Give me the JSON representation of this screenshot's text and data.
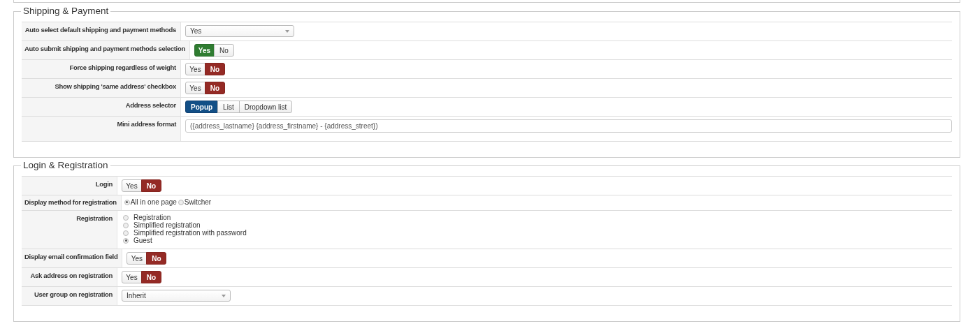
{
  "sections": [
    {
      "title": "Shipping & Payment",
      "rows": [
        {
          "label": "Auto select default shipping and payment methods",
          "kind": "select",
          "value": "Yes"
        },
        {
          "label": "Auto submit shipping and payment methods selection",
          "kind": "toggle",
          "options": [
            {
              "label": "Yes",
              "selected": true
            },
            {
              "label": "No",
              "selected": false
            }
          ]
        },
        {
          "label": "Force shipping regardless of weight",
          "kind": "toggle",
          "options": [
            {
              "label": "Yes",
              "selected": false
            },
            {
              "label": "No",
              "selected": true
            }
          ]
        },
        {
          "label": "Show shipping 'same address' checkbox",
          "kind": "toggle",
          "options": [
            {
              "label": "Yes",
              "selected": false
            },
            {
              "label": "No",
              "selected": true
            }
          ]
        },
        {
          "label": "Address selector",
          "kind": "segmented",
          "options": [
            {
              "label": "Popup",
              "selected": true
            },
            {
              "label": "List",
              "selected": false
            },
            {
              "label": "Dropdown list",
              "selected": false
            }
          ]
        },
        {
          "label": "Mini address format",
          "kind": "text",
          "value": "({address_lastname} {address_firstname} - {address_street})"
        }
      ]
    },
    {
      "title": "Login & Registration",
      "rows": [
        {
          "label": "Login",
          "kind": "toggle",
          "options": [
            {
              "label": "Yes",
              "selected": false
            },
            {
              "label": "No",
              "selected": true
            }
          ]
        },
        {
          "label": "Display method for registration",
          "kind": "radio-inline",
          "options": [
            {
              "label": "All in one page",
              "selected": true
            },
            {
              "label": "Switcher",
              "selected": false
            }
          ]
        },
        {
          "label": "Registration",
          "kind": "radio-list",
          "options": [
            {
              "label": "Registration",
              "selected": false
            },
            {
              "label": "Simplified registration",
              "selected": false
            },
            {
              "label": "Simplified registration with password",
              "selected": false
            },
            {
              "label": "Guest",
              "selected": true
            }
          ]
        },
        {
          "label": "Display email confirmation field",
          "kind": "toggle",
          "options": [
            {
              "label": "Yes",
              "selected": false
            },
            {
              "label": "No",
              "selected": true
            }
          ]
        },
        {
          "label": "Ask address on registration",
          "kind": "toggle",
          "options": [
            {
              "label": "Yes",
              "selected": false
            },
            {
              "label": "No",
              "selected": true
            }
          ]
        },
        {
          "label": "User group on registration",
          "kind": "select",
          "value": "Inherit"
        }
      ]
    }
  ]
}
